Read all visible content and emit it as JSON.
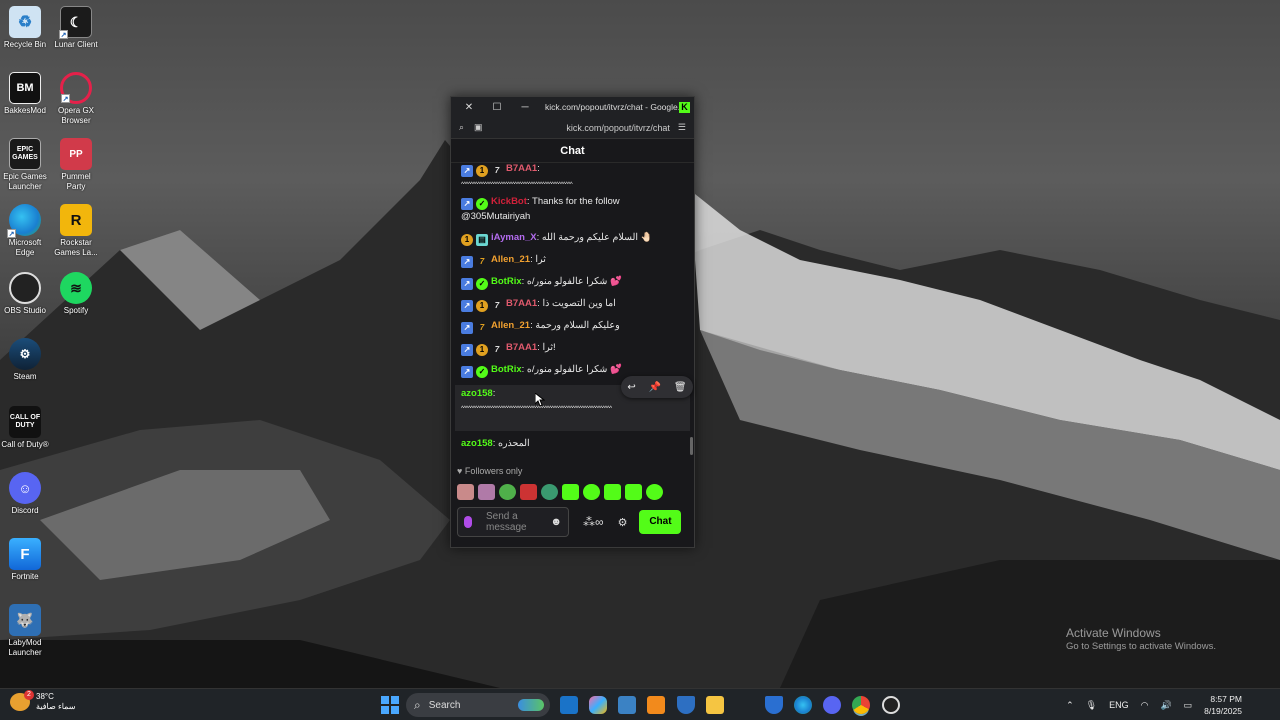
{
  "desktop": {
    "icons": [
      {
        "label": "Recycle Bin",
        "icon": "recycle-bin-icon"
      },
      {
        "label": "Lunar Client",
        "icon": "lunar-client-icon"
      },
      {
        "label": "BakkesMod",
        "icon": "bakkesmod-icon"
      },
      {
        "label": "Opera GX Browser",
        "icon": "opera-gx-icon"
      },
      {
        "label": "Epic Games Launcher",
        "icon": "epic-games-icon"
      },
      {
        "label": "Pummel Party",
        "icon": "pummel-party-icon"
      },
      {
        "label": "Microsoft Edge",
        "icon": "edge-icon"
      },
      {
        "label": "Rockstar Games La...",
        "icon": "rockstar-icon"
      },
      {
        "label": "OBS Studio",
        "icon": "obs-icon"
      },
      {
        "label": "Spotify",
        "icon": "spotify-icon"
      },
      {
        "label": "Steam",
        "icon": "steam-icon"
      },
      {
        "label": "Call of Duty®",
        "icon": "call-of-duty-icon"
      },
      {
        "label": "Discord",
        "icon": "discord-icon"
      },
      {
        "label": "Fortnite",
        "icon": "fortnite-icon"
      },
      {
        "label": "LabyMod Launcher",
        "icon": "labymod-icon"
      }
    ],
    "icon_glyphs": {
      "epic": "EPIC GAMES",
      "cod": "CALL OF DUTY",
      "rockstar": "R",
      "fortnite": "F",
      "bakkes": "BM"
    }
  },
  "browser": {
    "title": "kick.com/popout/itvrz/chat - Google...",
    "url": "kick.com/popout/itvrz/chat",
    "kick_logo": "K"
  },
  "chat": {
    "header": "Chat",
    "messages": [
      {
        "user": "B7AA1",
        "text": "^^^^^^^^^^^^^^^^^^^^^^^^^^^^^^^^^^^^^^^^^^^^^^^^",
        "color": "#e05a6d"
      },
      {
        "user": "KickBot",
        "text": "Thanks for the follow @305Mutairiyah",
        "color": "#d2213a"
      },
      {
        "user": "iAyman_X",
        "text": "السلام عليكم ورحمة الله 🤚🏻",
        "color": "#b46cf0"
      },
      {
        "user": "Allen_21",
        "text": "ثرا",
        "color": "#f0a030"
      },
      {
        "user": "BotRix",
        "text": "شكرا عالفولو منور/ه 💕",
        "color": "#53fc18"
      },
      {
        "user": "B7AA1",
        "text": "اما وين التصويت ذا",
        "color": "#e05a6d"
      },
      {
        "user": "Allen_21",
        "text": "وعليكم السلام ورحمة",
        "color": "#f0a030"
      },
      {
        "user": "B7AA1",
        "text": "ثرا!",
        "color": "#e05a6d"
      },
      {
        "user": "BotRix",
        "text": "شكرا عالفولو منور/ه 💕",
        "color": "#53fc18"
      },
      {
        "user": "azo158",
        "text": "^^^^^^^^^^^^^^^^^^^^^^^^^^^^^^^^^^^^^^^^^^^^^^^^^^^^^^^^^^^^^^^^^",
        "color": "#53fc18"
      },
      {
        "user": "azo158",
        "text": "المحذره",
        "color": "#53fc18"
      }
    ],
    "followers_only": "Followers only",
    "input_placeholder": "Send a message",
    "chat_button": "Chat",
    "badge_glyphs": {
      "sub": "1",
      "verified": "✓",
      "og": "7"
    }
  },
  "watermark": {
    "line1": "Activate Windows",
    "line2": "Go to Settings to activate Windows."
  },
  "taskbar": {
    "weather_temp": "38°C",
    "weather_desc": "سماء صافية",
    "weather_alert": "2",
    "search_label": "Search",
    "lang": "ENG",
    "time": "8:57 PM",
    "date": "8/19/2025"
  }
}
